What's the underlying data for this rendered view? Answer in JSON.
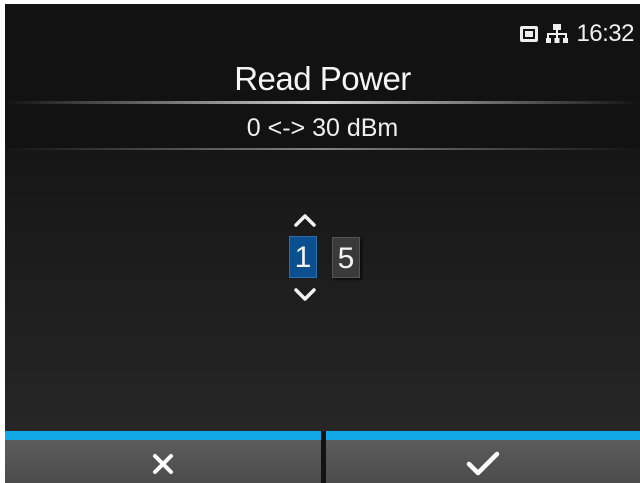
{
  "status_bar": {
    "time": "16:32",
    "icons": [
      "memory-card-icon",
      "network-icon"
    ]
  },
  "header": {
    "title": "Read Power",
    "range_label": "0 <-> 30 dBm"
  },
  "editor": {
    "digits": [
      "1",
      "5"
    ],
    "selected_digit_index": 0,
    "value": 15,
    "unit": "dBm"
  },
  "footer": {
    "buttons": [
      {
        "name": "cancel",
        "icon": "x-icon"
      },
      {
        "name": "confirm",
        "icon": "checkmark-icon"
      }
    ],
    "accent_color": "#12a7e6"
  },
  "colors": {
    "background": "#121212",
    "selected_digit": "#0c4f8f",
    "unselected_digit": "#3a3a3a",
    "button": "#555555"
  }
}
